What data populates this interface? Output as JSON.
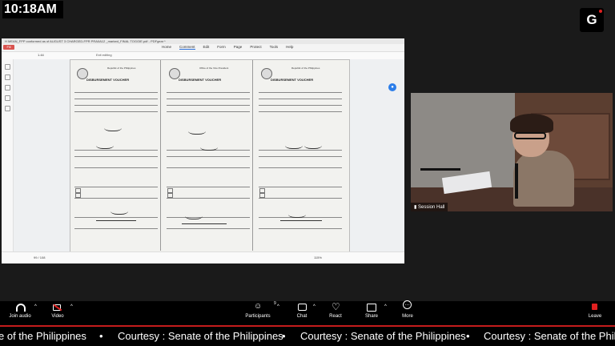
{
  "clock": "10:18AM",
  "user_initial": "G",
  "pdf": {
    "title": "H  MEAN_FPP conformed as of AUGUST 3 CHARGED-FPR PRA0A12 _marked_FINAL TOGGIE.pdf - PDFgear *",
    "fill_button": "Fill",
    "menu": [
      "Home",
      "Comment",
      "Edit",
      "Form",
      "Page",
      "Protect",
      "Tools",
      "Help"
    ],
    "active_menu": "Comment",
    "zoom_small": "1.44",
    "edit_link": "Exit editing",
    "voucher_republic": "Republic of the Philippines",
    "voucher_office": "Office of the Vice President",
    "voucher_title": "DISBURSEMENT VOUCHER",
    "page_indicator": "99 / 108",
    "zoom": "115%"
  },
  "video": {
    "label": "Session Hall"
  },
  "controls": {
    "join_audio": "Join audio",
    "video": "Video",
    "participants": "Participants",
    "participants_count": "9",
    "chat": "Chat",
    "react": "React",
    "share": "Share",
    "more": "More",
    "leave": "Leave"
  },
  "ticker": {
    "text": "Courtesy : Senate of the Philippines",
    "partial": "e of the Philippines",
    "bullet": "•"
  }
}
